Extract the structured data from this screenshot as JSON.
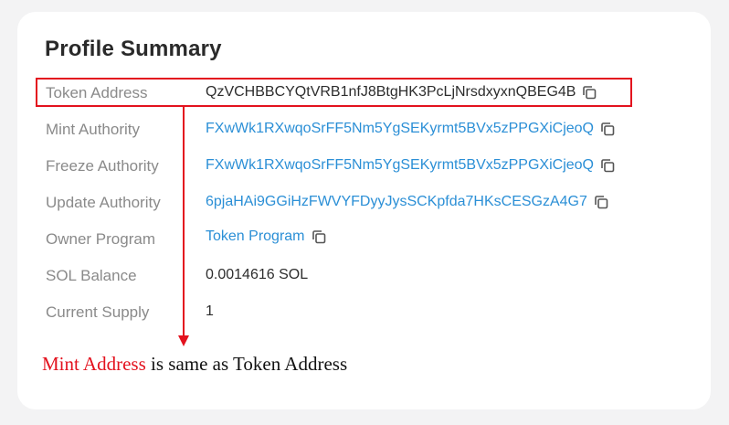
{
  "profile": {
    "title": "Profile Summary",
    "rows": [
      {
        "label": "Token Address",
        "value": "QzVCHBBCYQtVRB1nfJ8BtgHK3PcLjNrsdxyxnQBEG4B",
        "link": false,
        "copy": true
      },
      {
        "label": "Mint Authority",
        "value": "FXwWk1RXwqoSrFF5Nm5YgSEKyrmt5BVx5zPPGXiCjeoQ",
        "link": true,
        "copy": true
      },
      {
        "label": "Freeze Authority",
        "value": "FXwWk1RXwqoSrFF5Nm5YgSEKyrmt5BVx5zPPGXiCjeoQ",
        "link": true,
        "copy": true
      },
      {
        "label": "Update Authority",
        "value": "6pjaHAi9GGiHzFWVYFDyyJysSCKpfda7HKsCESGzA4G7",
        "link": true,
        "copy": true
      },
      {
        "label": "Owner Program",
        "value": "Token Program",
        "link": true,
        "copy": true
      },
      {
        "label": "SOL Balance",
        "value": "0.0014616 SOL",
        "link": false,
        "copy": false
      },
      {
        "label": "Current Supply",
        "value": "1",
        "link": false,
        "copy": false
      }
    ]
  },
  "annotation": {
    "highlight": "Mint Address",
    "rest": " is same as Token Address"
  },
  "colors": {
    "accent_link": "#2b8fd6",
    "annotation_red": "#e3121e"
  },
  "icons": {
    "copy": "copy-icon"
  }
}
